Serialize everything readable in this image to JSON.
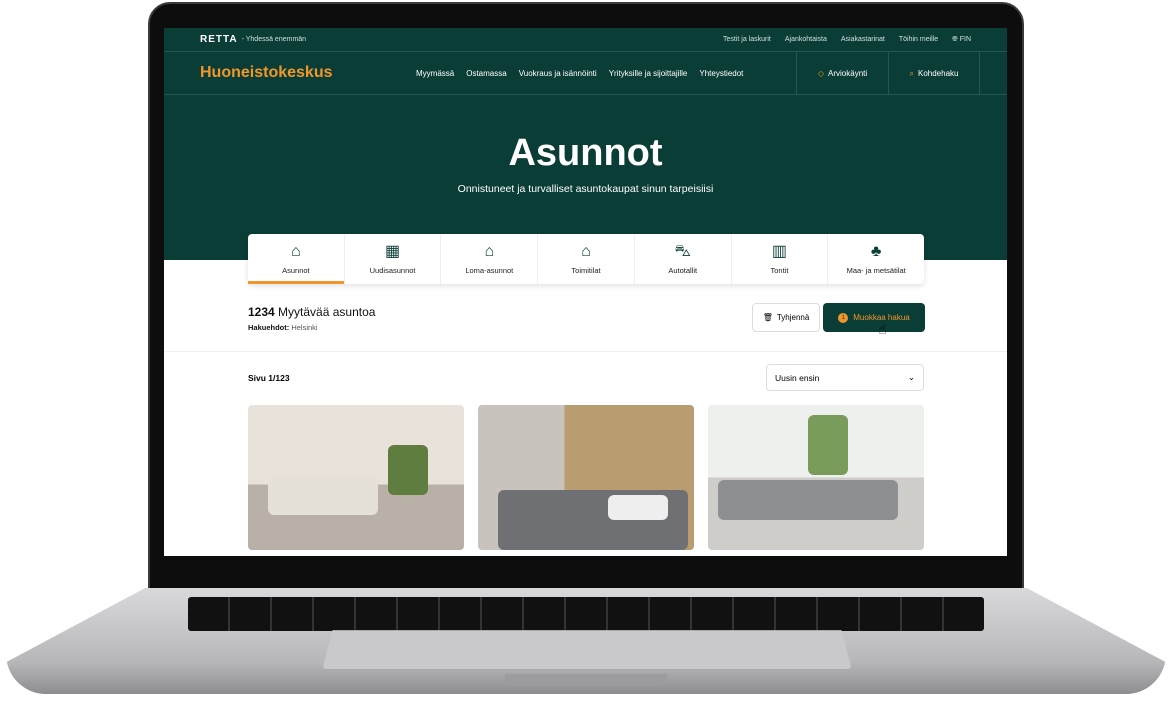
{
  "topbar": {
    "logo": "RETTA",
    "tagline": "- Yhdessä enemmän",
    "links": [
      "Testit ja laskurit",
      "Ajankohtaista",
      "Asiakastarinat",
      "Töihin meille"
    ],
    "language": "FIN"
  },
  "nav": {
    "brand": "Huoneistokeskus",
    "links": [
      "Myymässä",
      "Ostamassa",
      "Vuokraus ja isännöinti",
      "Yrityksille ja sijoittajille",
      "Yhteystiedot"
    ],
    "appraisal": "Arviokäynti",
    "search": "Kohdehaku"
  },
  "hero": {
    "title": "Asunnot",
    "subtitle": "Onnistuneet ja turvalliset asuntokaupat sinun tarpeisiisi"
  },
  "tabs": [
    {
      "label": "Asunnot",
      "icon": "house-icon",
      "active": true
    },
    {
      "label": "Uudisasunnot",
      "icon": "new-building-icon"
    },
    {
      "label": "Loma-asunnot",
      "icon": "cabin-icon"
    },
    {
      "label": "Toimitilat",
      "icon": "office-icon"
    },
    {
      "label": "Autotallit",
      "icon": "car-icon"
    },
    {
      "label": "Tontit",
      "icon": "map-icon"
    },
    {
      "label": "Maa- ja metsätilat",
      "icon": "trees-icon"
    }
  ],
  "results": {
    "count": "1234",
    "count_label": "Myytävää asuntoa",
    "criteria_label": "Hakuehdot:",
    "criteria_value": "Helsinki",
    "clear": "Tyhjennä",
    "edit": "Muokkaa hakua",
    "edit_badge": "1",
    "page": "Sivu 1/123",
    "sort": "Uusin ensin"
  },
  "colors": {
    "brand_green": "#0b3d37",
    "accent_orange": "#f0962a"
  }
}
